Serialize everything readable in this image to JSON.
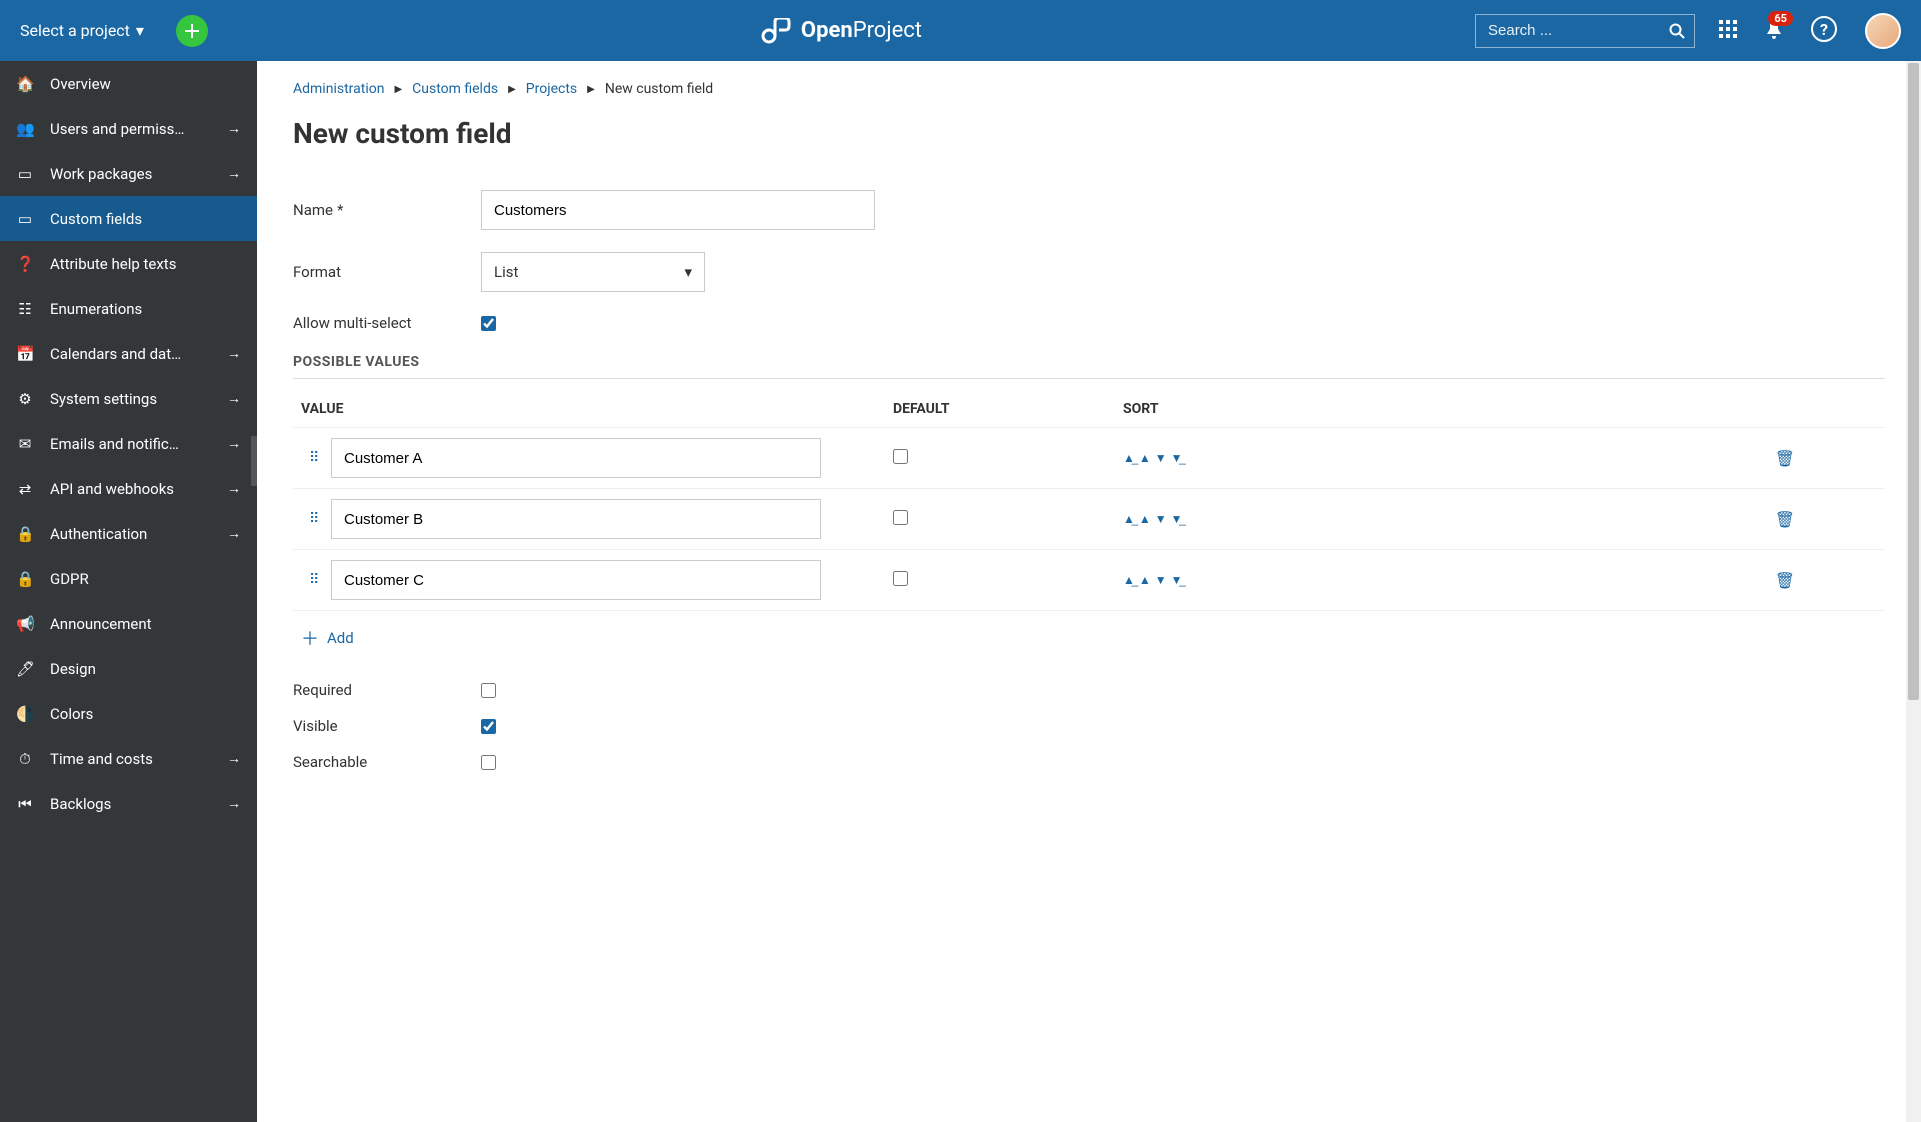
{
  "header": {
    "project_select": "Select a project",
    "logo_text": "OpenProject",
    "search_placeholder": "Search ...",
    "notification_count": "65"
  },
  "sidebar": {
    "items": [
      {
        "label": "Overview",
        "arrow": false
      },
      {
        "label": "Users and permiss…",
        "arrow": true
      },
      {
        "label": "Work packages",
        "arrow": true
      },
      {
        "label": "Custom fields",
        "arrow": false,
        "active": true
      },
      {
        "label": "Attribute help texts",
        "arrow": false
      },
      {
        "label": "Enumerations",
        "arrow": false
      },
      {
        "label": "Calendars and dat…",
        "arrow": true
      },
      {
        "label": "System settings",
        "arrow": true
      },
      {
        "label": "Emails and notific…",
        "arrow": true
      },
      {
        "label": "API and webhooks",
        "arrow": true
      },
      {
        "label": "Authentication",
        "arrow": true
      },
      {
        "label": "GDPR",
        "arrow": false
      },
      {
        "label": "Announcement",
        "arrow": false
      },
      {
        "label": "Design",
        "arrow": false
      },
      {
        "label": "Colors",
        "arrow": false
      },
      {
        "label": "Time and costs",
        "arrow": true
      },
      {
        "label": "Backlogs",
        "arrow": true
      }
    ]
  },
  "breadcrumb": {
    "items": [
      "Administration",
      "Custom fields",
      "Projects"
    ],
    "current": "New custom field"
  },
  "page": {
    "title": "New custom field",
    "labels": {
      "name": "Name",
      "format": "Format",
      "allow_multi": "Allow multi-select",
      "section": "POSSIBLE VALUES",
      "col_value": "VALUE",
      "col_default": "DEFAULT",
      "col_sort": "SORT",
      "add": "Add",
      "required": "Required",
      "visible": "Visible",
      "searchable": "Searchable"
    },
    "form": {
      "name_value": "Customers",
      "format_value": "List",
      "allow_multi_checked": true,
      "required_checked": false,
      "visible_checked": true,
      "searchable_checked": false
    },
    "values": [
      {
        "text": "Customer A",
        "default": false
      },
      {
        "text": "Customer B",
        "default": false
      },
      {
        "text": "Customer C",
        "default": false
      }
    ]
  }
}
